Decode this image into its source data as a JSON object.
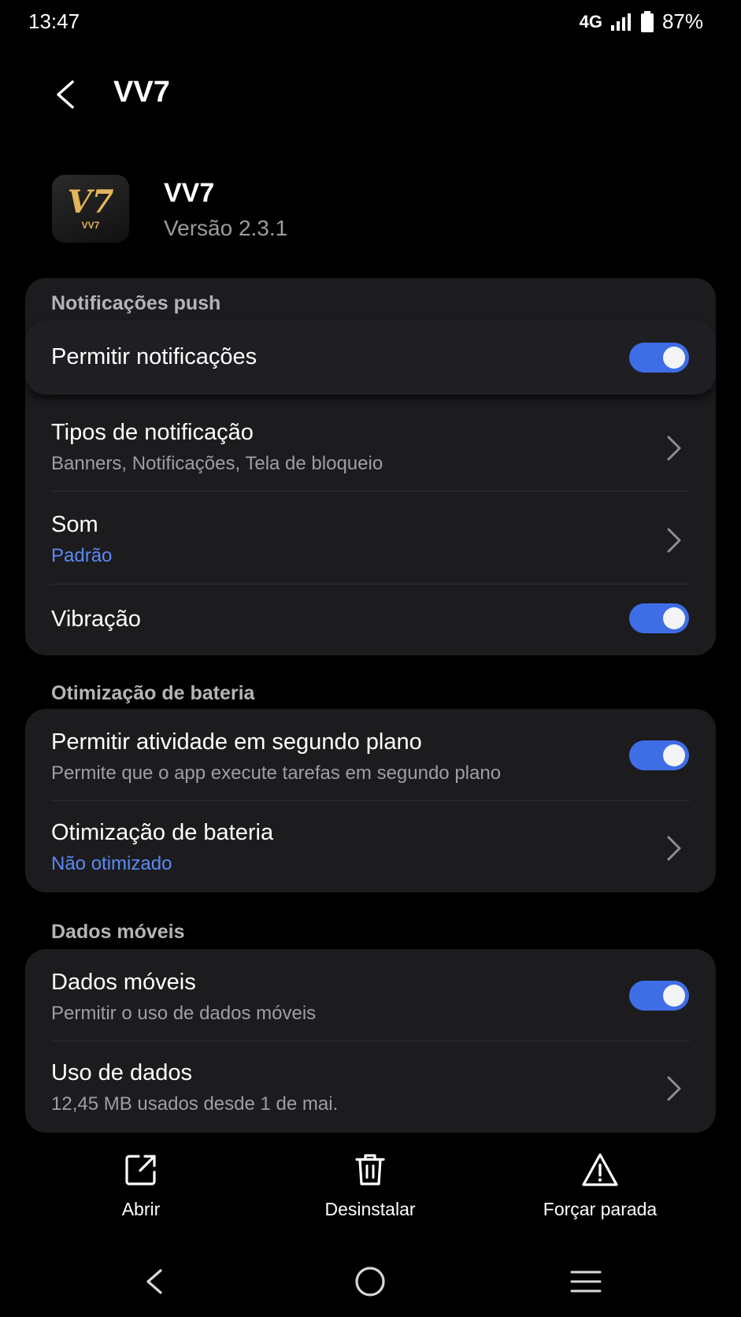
{
  "status": {
    "time": "13:47",
    "network": "4G",
    "battery": "87%"
  },
  "header": {
    "title": "VV7"
  },
  "app": {
    "name": "VV7",
    "version": "Versão 2.3.1",
    "icon_text": "V7",
    "icon_subtext": "VV7"
  },
  "notifications": {
    "section_label": "Notificações push",
    "allow": {
      "title": "Permitir notificações",
      "enabled": true
    },
    "types": {
      "title": "Tipos de notificação",
      "subtitle": "Banners, Notificações, Tela de bloqueio"
    },
    "sound": {
      "title": "Som",
      "subtitle": "Padrão"
    },
    "vibration": {
      "title": "Vibração",
      "enabled": true
    }
  },
  "battery": {
    "section_label": "Otimização de bateria",
    "background": {
      "title": "Permitir atividade em segundo plano",
      "subtitle": "Permite que o app execute tarefas em segundo plano",
      "enabled": true
    },
    "optimization": {
      "title": "Otimização de bateria",
      "subtitle": "Não otimizado"
    }
  },
  "mobile_data": {
    "section_label": "Dados móveis",
    "data": {
      "title": "Dados móveis",
      "subtitle": "Permitir o uso de dados móveis",
      "enabled": true
    },
    "usage": {
      "title": "Uso de dados",
      "subtitle": "12,45 MB usados desde 1 de mai."
    }
  },
  "actions": {
    "open": "Abrir",
    "uninstall": "Desinstalar",
    "force_stop": "Forçar parada"
  },
  "colors": {
    "accent": "#3e6de6",
    "link": "#5b8af5",
    "card": "#1c1c1f",
    "background": "#000000"
  },
  "icons": [
    "back-icon",
    "signal-icon",
    "battery-icon",
    "chevron-right-icon",
    "open-external-icon",
    "trash-icon",
    "warning-icon",
    "nav-back-icon",
    "nav-home-icon",
    "nav-menu-icon"
  ]
}
